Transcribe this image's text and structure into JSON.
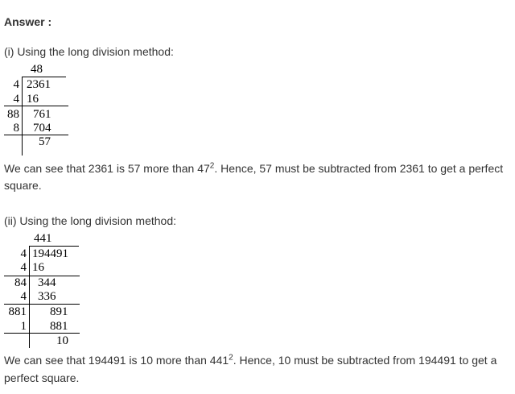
{
  "answer_heading": "Answer :",
  "part1": {
    "intro": "(i) Using the long division method:",
    "quotient": "48",
    "rows": [
      {
        "left": "4",
        "right": "2361"
      },
      {
        "left": "4",
        "right": "16"
      },
      {
        "left": "88",
        "right": "761"
      },
      {
        "left": "8",
        "right": "704"
      },
      {
        "left": "",
        "right": "57"
      }
    ],
    "conclusion_before": "We can see that 2361 is 57 more than 47",
    "conclusion_exp": "2",
    "conclusion_after": ". Hence, 57 must be subtracted from 2361 to get a perfect",
    "conclusion_line2": "square."
  },
  "part2": {
    "intro": "(ii) Using the long division method:",
    "quotient": "441",
    "rows": [
      {
        "left": "4",
        "right": "194491"
      },
      {
        "left": "4",
        "right": "16"
      },
      {
        "left": "84",
        "right": "344"
      },
      {
        "left": "4",
        "right": "336"
      },
      {
        "left": "881",
        "right": "891"
      },
      {
        "left": "1",
        "right": "881"
      },
      {
        "left": "",
        "right": "10"
      }
    ],
    "conclusion_before": "We can see that 194491 is 10 more than 441",
    "conclusion_exp": "2",
    "conclusion_after": ". Hence, 10 must be subtracted from 194491 to get a",
    "conclusion_line2": "perfect square."
  }
}
